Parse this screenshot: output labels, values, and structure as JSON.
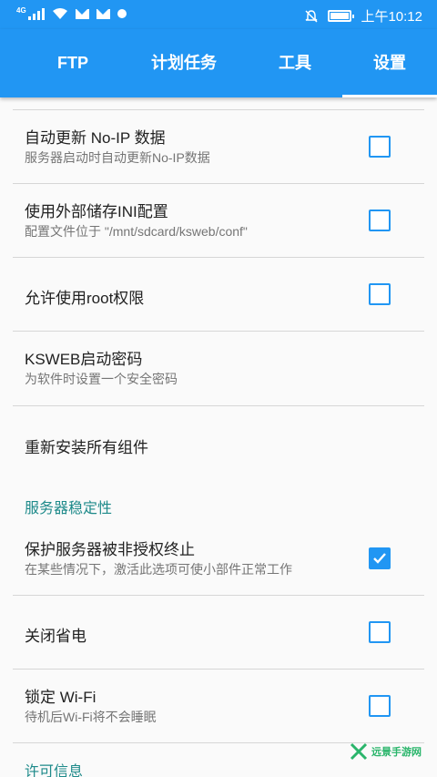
{
  "status_bar": {
    "network_type": "4G",
    "time": "上午10:12"
  },
  "tabs": [
    {
      "label": "FTP",
      "active": false
    },
    {
      "label": "计划任务",
      "active": false
    },
    {
      "label": "工具",
      "active": false
    },
    {
      "label": "设置",
      "active": true
    }
  ],
  "settings": [
    {
      "title": "自动更新 No-IP 数据",
      "subtitle": "服务器启动时自动更新No-IP数据",
      "checked": false
    },
    {
      "title": "使用外部储存INI配置",
      "subtitle": "配置文件位于 \"/mnt/sdcard/ksweb/conf\"",
      "checked": false
    },
    {
      "title": "允许使用root权限",
      "subtitle": "",
      "checked": false
    },
    {
      "title": "KSWEB启动密码",
      "subtitle": "为软件时设置一个安全密码"
    },
    {
      "title": "重新安装所有组件",
      "subtitle": ""
    }
  ],
  "section_stability": "服务器稳定性",
  "stability_settings": [
    {
      "title": "保护服务器被非授权终止",
      "subtitle": "在某些情况下，激活此选项可使小部件正常工作",
      "checked": true
    },
    {
      "title": "关闭省电",
      "subtitle": "",
      "checked": false
    },
    {
      "title": "锁定 Wi-Fi",
      "subtitle": "待机后Wi-Fi将不会睡眠",
      "checked": false
    }
  ],
  "section_license": "许可信息",
  "watermark": "远景手游网",
  "colors": {
    "accent": "#2196f3",
    "section": "#1e8a8a"
  }
}
